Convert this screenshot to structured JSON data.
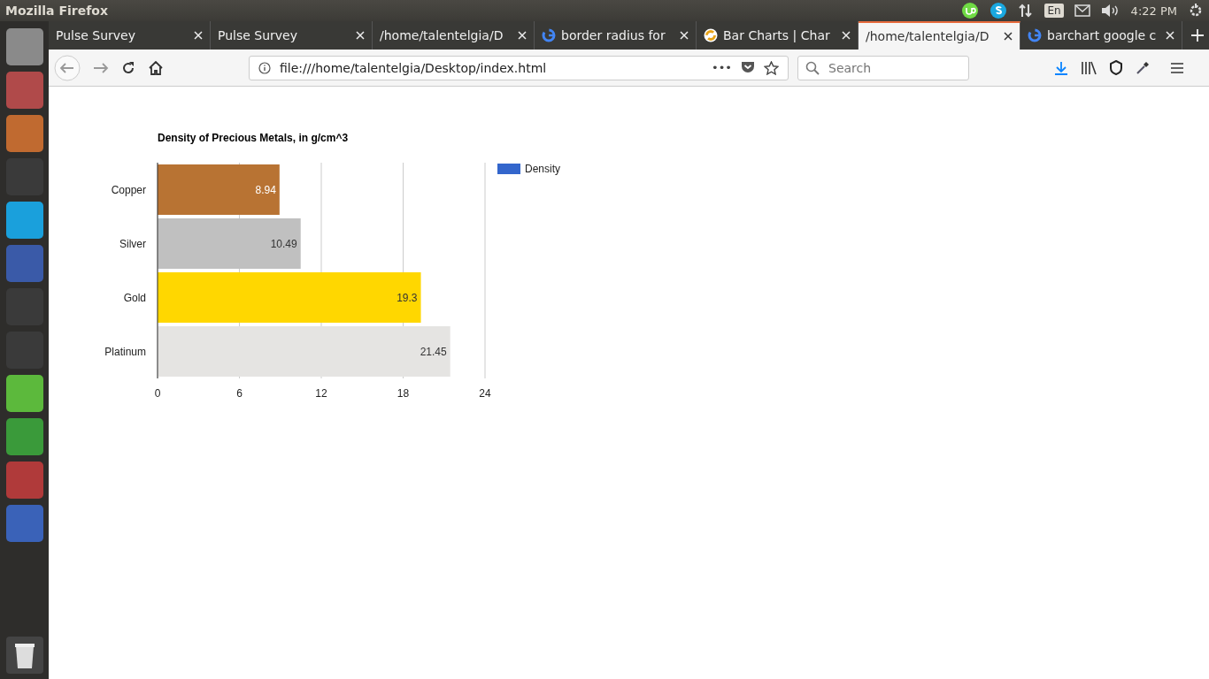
{
  "window": {
    "title": "Mozilla Firefox"
  },
  "tray": {
    "keyboard": "En",
    "time": "4:22 PM"
  },
  "tabs": [
    {
      "label": "Pulse Survey",
      "kind": "plain",
      "selected": false
    },
    {
      "label": "Pulse Survey",
      "kind": "plain",
      "selected": false
    },
    {
      "label": "/home/talentelgia/D",
      "kind": "plain",
      "selected": false
    },
    {
      "label": "border radius for",
      "kind": "google",
      "selected": false
    },
    {
      "label": "Bar Charts | Char",
      "kind": "chart",
      "selected": false
    },
    {
      "label": "/home/talentelgia/D",
      "kind": "plain",
      "selected": true
    },
    {
      "label": "barchart google c",
      "kind": "google",
      "selected": false
    }
  ],
  "toolbar": {
    "url": "file:///home/talentelgia/Desktop/index.html",
    "page_actions": "•••",
    "search": {
      "placeholder": "Search"
    }
  },
  "chart": {
    "chart_data": {
      "type": "bar",
      "orientation": "horizontal",
      "title": "Density of Precious Metals, in g/cm^3",
      "categories": [
        "Copper",
        "Silver",
        "Gold",
        "Platinum"
      ],
      "series": [
        {
          "name": "Density",
          "values": [
            8.94,
            10.49,
            19.3,
            21.45
          ]
        }
      ],
      "value_labels": [
        "8.94",
        "10.49",
        "19.3",
        "21.45"
      ],
      "grid": true,
      "xlim": [
        0,
        24
      ],
      "xticks": [
        0,
        6,
        12,
        18,
        24
      ]
    },
    "legend": {
      "color": "#3366cc"
    },
    "bars": [
      {
        "color": "#b87333"
      },
      {
        "color": "#c0c0c0"
      },
      {
        "color": "#ffd700"
      },
      {
        "color": "#e5e4e2"
      }
    ]
  }
}
